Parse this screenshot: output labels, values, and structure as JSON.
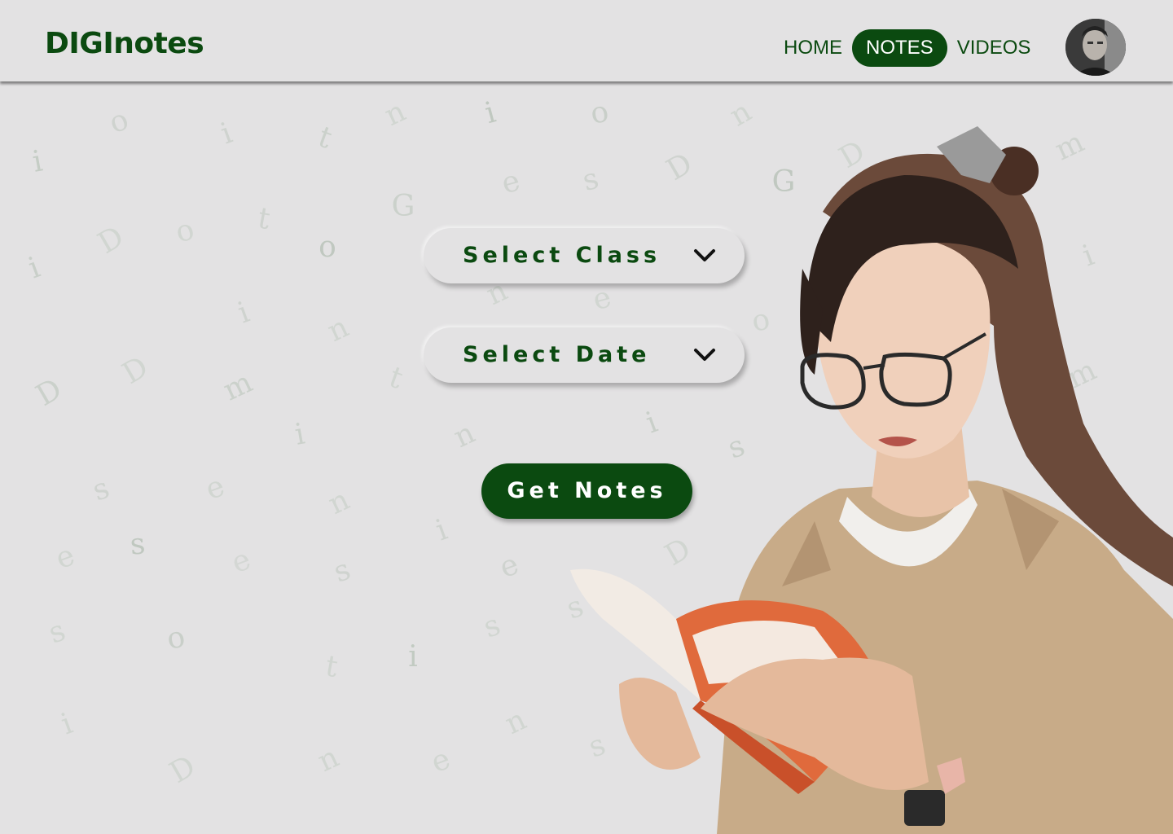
{
  "brand": {
    "logo": "DIGInotes"
  },
  "nav": {
    "items": [
      "HOME",
      "NOTES",
      "VIDEOS"
    ],
    "active": "NOTES"
  },
  "form": {
    "class_dropdown": {
      "label": "Select Class",
      "icon": "chevron-down-icon"
    },
    "date_dropdown": {
      "label": "Select Date",
      "icon": "chevron-down-icon"
    },
    "submit_label": "Get Notes"
  },
  "background_letters": "DIGInotes",
  "colors": {
    "primary": "#0b4a10",
    "background": "#e3e2e3",
    "letters": "#a8b8a8"
  }
}
